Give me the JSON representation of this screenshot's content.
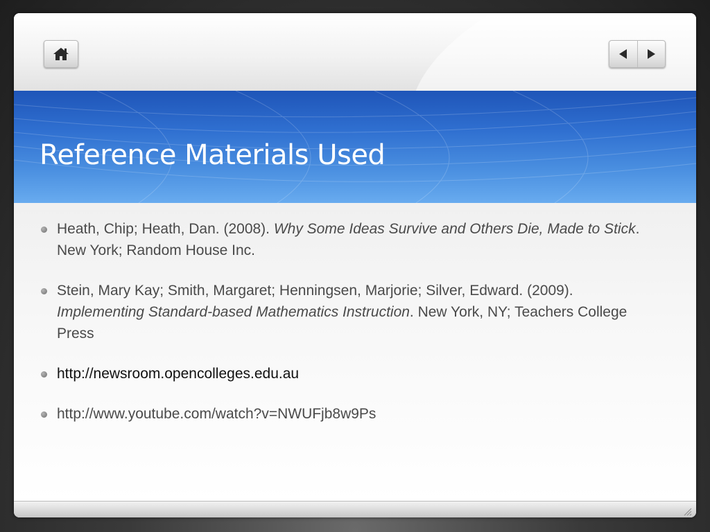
{
  "nav": {
    "home_icon": "home-icon",
    "prev_icon": "triangle-left-icon",
    "next_icon": "triangle-right-icon"
  },
  "slide": {
    "title": "Reference Materials Used",
    "references": [
      {
        "before": "Heath, Chip; Heath, Dan. (2008). ",
        "italic": "Why Some Ideas Survive and Others Die, Made to Stick",
        "after": ". New York; Random House Inc."
      },
      {
        "before": "Stein, Mary Kay; Smith, Margaret; Henningsen, Marjorie; Silver, Edward. (2009). ",
        "italic": "Implementing Standard-based Mathematics Instruction",
        "after": ".  New York, NY; Teachers College Press"
      },
      {
        "text": "http://newsroom.opencolleges.edu.au"
      },
      {
        "text": "http://www.youtube.com/watch?v=NWUFjb8w9Ps"
      }
    ]
  },
  "colors": {
    "title_band_top": "#1f55b8",
    "title_band_bottom": "#68abef",
    "body_text": "#4a4a4a",
    "link_text": "#111111"
  }
}
